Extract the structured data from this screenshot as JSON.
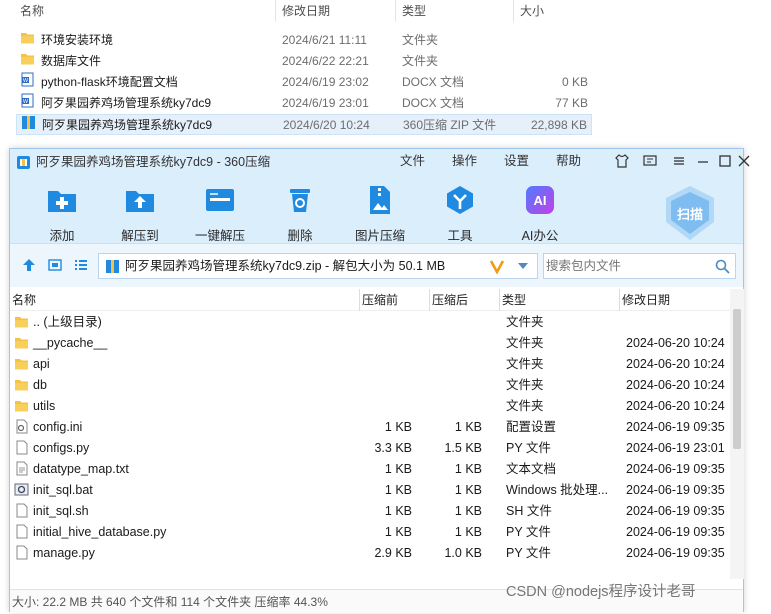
{
  "explorer": {
    "columns": [
      "名称",
      "修改日期",
      "类型",
      "大小"
    ],
    "rows": [
      {
        "name": "环境安装环境",
        "date": "2024/6/21 11:11",
        "type": "文件夹",
        "size": "",
        "icon": "folder-icon"
      },
      {
        "name": "数据库文件",
        "date": "2024/6/22 22:21",
        "type": "文件夹",
        "size": "",
        "icon": "folder-icon"
      },
      {
        "name": "python-flask环境配置文档",
        "date": "2024/6/19 23:02",
        "type": "DOCX 文档",
        "size": "0 KB",
        "icon": "docx-icon"
      },
      {
        "name": "阿歹果园养鸡场管理系统ky7dc9",
        "date": "2024/6/19 23:01",
        "type": "DOCX 文档",
        "size": "77 KB",
        "icon": "docx-icon"
      },
      {
        "name": "阿歹果园养鸡场管理系统ky7dc9",
        "date": "2024/6/20 10:24",
        "type": "360压缩 ZIP 文件",
        "size": "22,898 KB",
        "icon": "zip-icon"
      }
    ]
  },
  "app": {
    "title": "阿歹果园养鸡场管理系统ky7dc9 - 360压缩",
    "menu": [
      "文件",
      "操作",
      "设置",
      "帮助"
    ],
    "tools": [
      "添加",
      "解压到",
      "一键解压",
      "删除",
      "图片压缩",
      "工具",
      "AI办公"
    ],
    "scan_label": "扫描",
    "address": "阿歹果园养鸡场管理系统ky7dc9.zip - 解包大小为 50.1 MB",
    "search_placeholder": "搜索包内文件",
    "columns": [
      "名称",
      "压缩前",
      "压缩后",
      "类型",
      "修改日期"
    ],
    "files": [
      {
        "name": ".. (上级目录)",
        "csize": "",
        "psize": "",
        "type": "文件夹",
        "date": "",
        "icon": "folder-icon"
      },
      {
        "name": "__pycache__",
        "csize": "",
        "psize": "",
        "type": "文件夹",
        "date": "2024-06-20 10:24",
        "icon": "folder-icon"
      },
      {
        "name": "api",
        "csize": "",
        "psize": "",
        "type": "文件夹",
        "date": "2024-06-20 10:24",
        "icon": "folder-icon"
      },
      {
        "name": "db",
        "csize": "",
        "psize": "",
        "type": "文件夹",
        "date": "2024-06-20 10:24",
        "icon": "folder-icon"
      },
      {
        "name": "utils",
        "csize": "",
        "psize": "",
        "type": "文件夹",
        "date": "2024-06-20 10:24",
        "icon": "folder-icon"
      },
      {
        "name": "config.ini",
        "csize": "1 KB",
        "psize": "1 KB",
        "type": "配置设置",
        "date": "2024-06-19 09:35",
        "icon": "config-file-icon"
      },
      {
        "name": "configs.py",
        "csize": "3.3 KB",
        "psize": "1.5 KB",
        "type": "PY 文件",
        "date": "2024-06-19 23:01",
        "icon": "file-icon"
      },
      {
        "name": "datatype_map.txt",
        "csize": "1 KB",
        "psize": "1 KB",
        "type": "文本文档",
        "date": "2024-06-19 09:35",
        "icon": "text-file-icon"
      },
      {
        "name": "init_sql.bat",
        "csize": "1 KB",
        "psize": "1 KB",
        "type": "Windows 批处理...",
        "date": "2024-06-19 09:35",
        "icon": "bat-file-icon"
      },
      {
        "name": "init_sql.sh",
        "csize": "1 KB",
        "psize": "1 KB",
        "type": "SH 文件",
        "date": "2024-06-19 09:35",
        "icon": "file-icon"
      },
      {
        "name": "initial_hive_database.py",
        "csize": "1 KB",
        "psize": "1 KB",
        "type": "PY 文件",
        "date": "2024-06-19 09:35",
        "icon": "file-icon"
      },
      {
        "name": "manage.py",
        "csize": "2.9 KB",
        "psize": "1.0 KB",
        "type": "PY 文件",
        "date": "2024-06-19 09:35",
        "icon": "file-icon"
      }
    ],
    "status": "大小: 22.2 MB 共 640 个文件和 114 个文件夹 压缩率 44.3%"
  },
  "watermark": "CSDN @nodejs程序设计老哥",
  "colors": {
    "accent": "#1f8ae0",
    "titlebar": "#dbeefc",
    "folder": "#f5c243",
    "selection": "#e5f0fb"
  }
}
